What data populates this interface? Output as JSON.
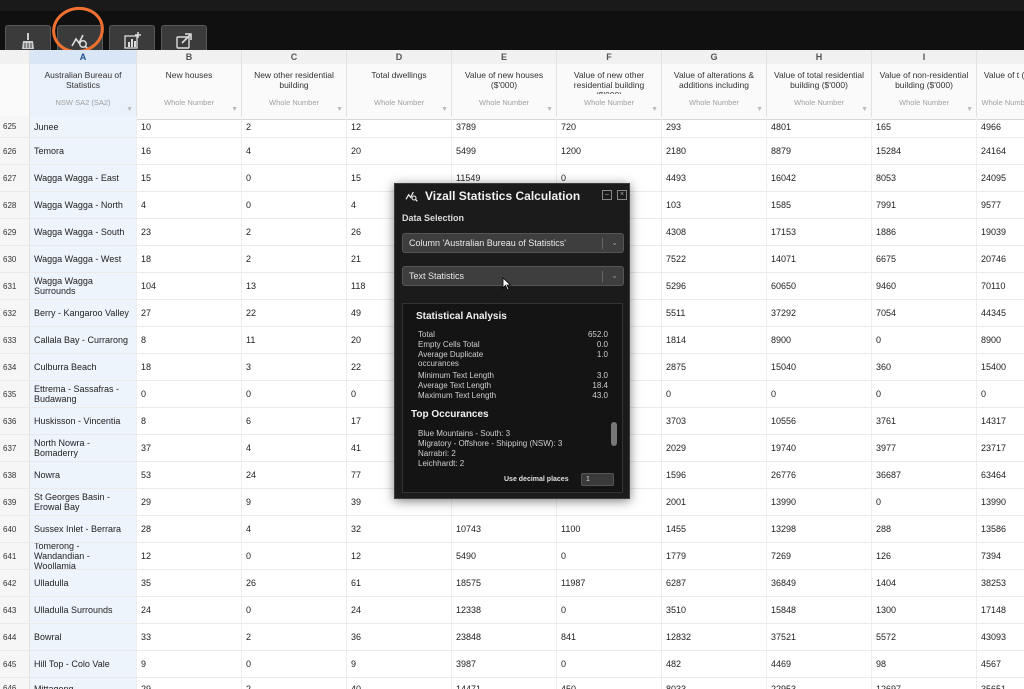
{
  "toolbar": {
    "buttons": [
      {
        "name": "clean-button",
        "icon": "broom-icon"
      },
      {
        "name": "statistics-button",
        "icon": "chart-magnify-icon"
      },
      {
        "name": "add-chart-button",
        "icon": "chart-add-icon"
      },
      {
        "name": "export-button",
        "icon": "share-export-icon"
      }
    ]
  },
  "grid": {
    "column_letters": [
      "A",
      "B",
      "C",
      "D",
      "E",
      "F",
      "G",
      "H",
      "I",
      ""
    ],
    "headers": [
      {
        "title": "Australian Bureau of Statistics",
        "subtitle": "NSW SA2 (SA2)"
      },
      {
        "title": "New houses",
        "subtitle": "Whole Number"
      },
      {
        "title": "New other residential building",
        "subtitle": "Whole Number"
      },
      {
        "title": "Total dwellings",
        "subtitle": "Whole Number"
      },
      {
        "title": "Value of new houses ($'000)",
        "subtitle": "Whole Number"
      },
      {
        "title": "Value of new other residential building ($'000)",
        "subtitle": "Whole Number"
      },
      {
        "title": "Value of alterations & additions including",
        "subtitle": "Whole Number"
      },
      {
        "title": "Value of total residential building ($'000)",
        "subtitle": "Whole Number"
      },
      {
        "title": "Value of non-residential building ($'000)",
        "subtitle": "Whole Number"
      },
      {
        "title": "Value of t ($",
        "subtitle": "Whole Number"
      }
    ],
    "rows": [
      {
        "n": "625",
        "cells": [
          "Junee",
          "10",
          "2",
          "12",
          "3789",
          "720",
          "293",
          "4801",
          "165",
          "4966"
        ]
      },
      {
        "n": "626",
        "cells": [
          "Temora",
          "16",
          "4",
          "20",
          "5499",
          "1200",
          "2180",
          "8879",
          "15284",
          "24164"
        ]
      },
      {
        "n": "627",
        "cells": [
          "Wagga Wagga - East",
          "15",
          "0",
          "15",
          "11549",
          "0",
          "4493",
          "16042",
          "8053",
          "24095"
        ]
      },
      {
        "n": "628",
        "cells": [
          "Wagga Wagga - North",
          "4",
          "0",
          "4",
          "",
          "",
          "103",
          "1585",
          "7991",
          "9577"
        ]
      },
      {
        "n": "629",
        "cells": [
          "Wagga Wagga - South",
          "23",
          "2",
          "26",
          "",
          "",
          "4308",
          "17153",
          "1886",
          "19039"
        ]
      },
      {
        "n": "630",
        "cells": [
          "Wagga Wagga - West",
          "18",
          "2",
          "21",
          "",
          "",
          "7522",
          "14071",
          "6675",
          "20746"
        ]
      },
      {
        "n": "631",
        "cells": [
          "Wagga Wagga Surrounds",
          "104",
          "13",
          "118",
          "",
          "",
          "5296",
          "60650",
          "9460",
          "70110"
        ]
      },
      {
        "n": "632",
        "cells": [
          "Berry - Kangaroo Valley",
          "27",
          "22",
          "49",
          "",
          "",
          "5511",
          "37292",
          "7054",
          "44345"
        ]
      },
      {
        "n": "633",
        "cells": [
          "Callala Bay - Currarong",
          "8",
          "11",
          "20",
          "",
          "",
          "1814",
          "8900",
          "0",
          "8900"
        ]
      },
      {
        "n": "634",
        "cells": [
          "Culburra Beach",
          "18",
          "3",
          "22",
          "",
          "",
          "2875",
          "15040",
          "360",
          "15400"
        ]
      },
      {
        "n": "635",
        "cells": [
          "Ettrema - Sassafras - Budawang",
          "0",
          "0",
          "0",
          "",
          "",
          "0",
          "0",
          "0",
          "0"
        ]
      },
      {
        "n": "636",
        "cells": [
          "Huskisson - Vincentia",
          "8",
          "6",
          "17",
          "",
          "",
          "3703",
          "10556",
          "3761",
          "14317"
        ]
      },
      {
        "n": "637",
        "cells": [
          "North Nowra - Bomaderry",
          "37",
          "4",
          "41",
          "",
          "",
          "2029",
          "19740",
          "3977",
          "23717"
        ]
      },
      {
        "n": "638",
        "cells": [
          "Nowra",
          "53",
          "24",
          "77",
          "",
          "",
          "1596",
          "26776",
          "36687",
          "63464"
        ]
      },
      {
        "n": "639",
        "cells": [
          "St Georges Basin - Erowal Bay",
          "29",
          "9",
          "39",
          "",
          "",
          "2001",
          "13990",
          "0",
          "13990"
        ]
      },
      {
        "n": "640",
        "cells": [
          "Sussex Inlet - Berrara",
          "28",
          "4",
          "32",
          "10743",
          "1100",
          "1455",
          "13298",
          "288",
          "13586"
        ]
      },
      {
        "n": "641",
        "cells": [
          "Tomerong - Wandandian - Woollamia",
          "12",
          "0",
          "12",
          "5490",
          "0",
          "1779",
          "7269",
          "126",
          "7394"
        ]
      },
      {
        "n": "642",
        "cells": [
          "Ulladulla",
          "35",
          "26",
          "61",
          "18575",
          "11987",
          "6287",
          "36849",
          "1404",
          "38253"
        ]
      },
      {
        "n": "643",
        "cells": [
          "Ulladulla Surrounds",
          "24",
          "0",
          "24",
          "12338",
          "0",
          "3510",
          "15848",
          "1300",
          "17148"
        ]
      },
      {
        "n": "644",
        "cells": [
          "Bowral",
          "33",
          "2",
          "36",
          "23848",
          "841",
          "12832",
          "37521",
          "5572",
          "43093"
        ]
      },
      {
        "n": "645",
        "cells": [
          "Hill Top - Colo Vale",
          "9",
          "0",
          "9",
          "3987",
          "0",
          "482",
          "4469",
          "98",
          "4567"
        ]
      },
      {
        "n": "646",
        "cells": [
          "Mittagong",
          "29",
          "2",
          "40",
          "14471",
          "450",
          "8033",
          "22953",
          "12697",
          "35651"
        ]
      }
    ]
  },
  "modal": {
    "title": "Vizall Statistics Calculation",
    "section_label": "Data Selection",
    "column_select": "Column 'Australian Bureau of Statistics'",
    "type_select": "Text Statistics",
    "analysis_heading": "Statistical Analysis",
    "stats": [
      {
        "label": "Total",
        "value": "652.0"
      },
      {
        "label": "Empty Cells Total",
        "value": "0.0"
      },
      {
        "label": "Average Duplicate occurances",
        "value": "1.0"
      },
      {
        "label": "Minimum Text Length",
        "value": "3.0"
      },
      {
        "label": "Average Text Length",
        "value": "18.4"
      },
      {
        "label": "Maximum Text Length",
        "value": "43.0"
      }
    ],
    "occurrences_heading": "Top Occurances",
    "occurrences": [
      "Blue Mountains - South: 3",
      "Migratory - Offshore - Shipping (NSW): 3",
      "Narrabri: 2",
      "Leichhardt: 2"
    ],
    "decimal_label": "Use decimal places",
    "decimal_value": "1"
  },
  "colors": {
    "toolbar_bg": "#101010",
    "selected_column": "#eef4fc",
    "modal_bg": "#1b1b1b",
    "annotation_circle": "#f07030"
  }
}
